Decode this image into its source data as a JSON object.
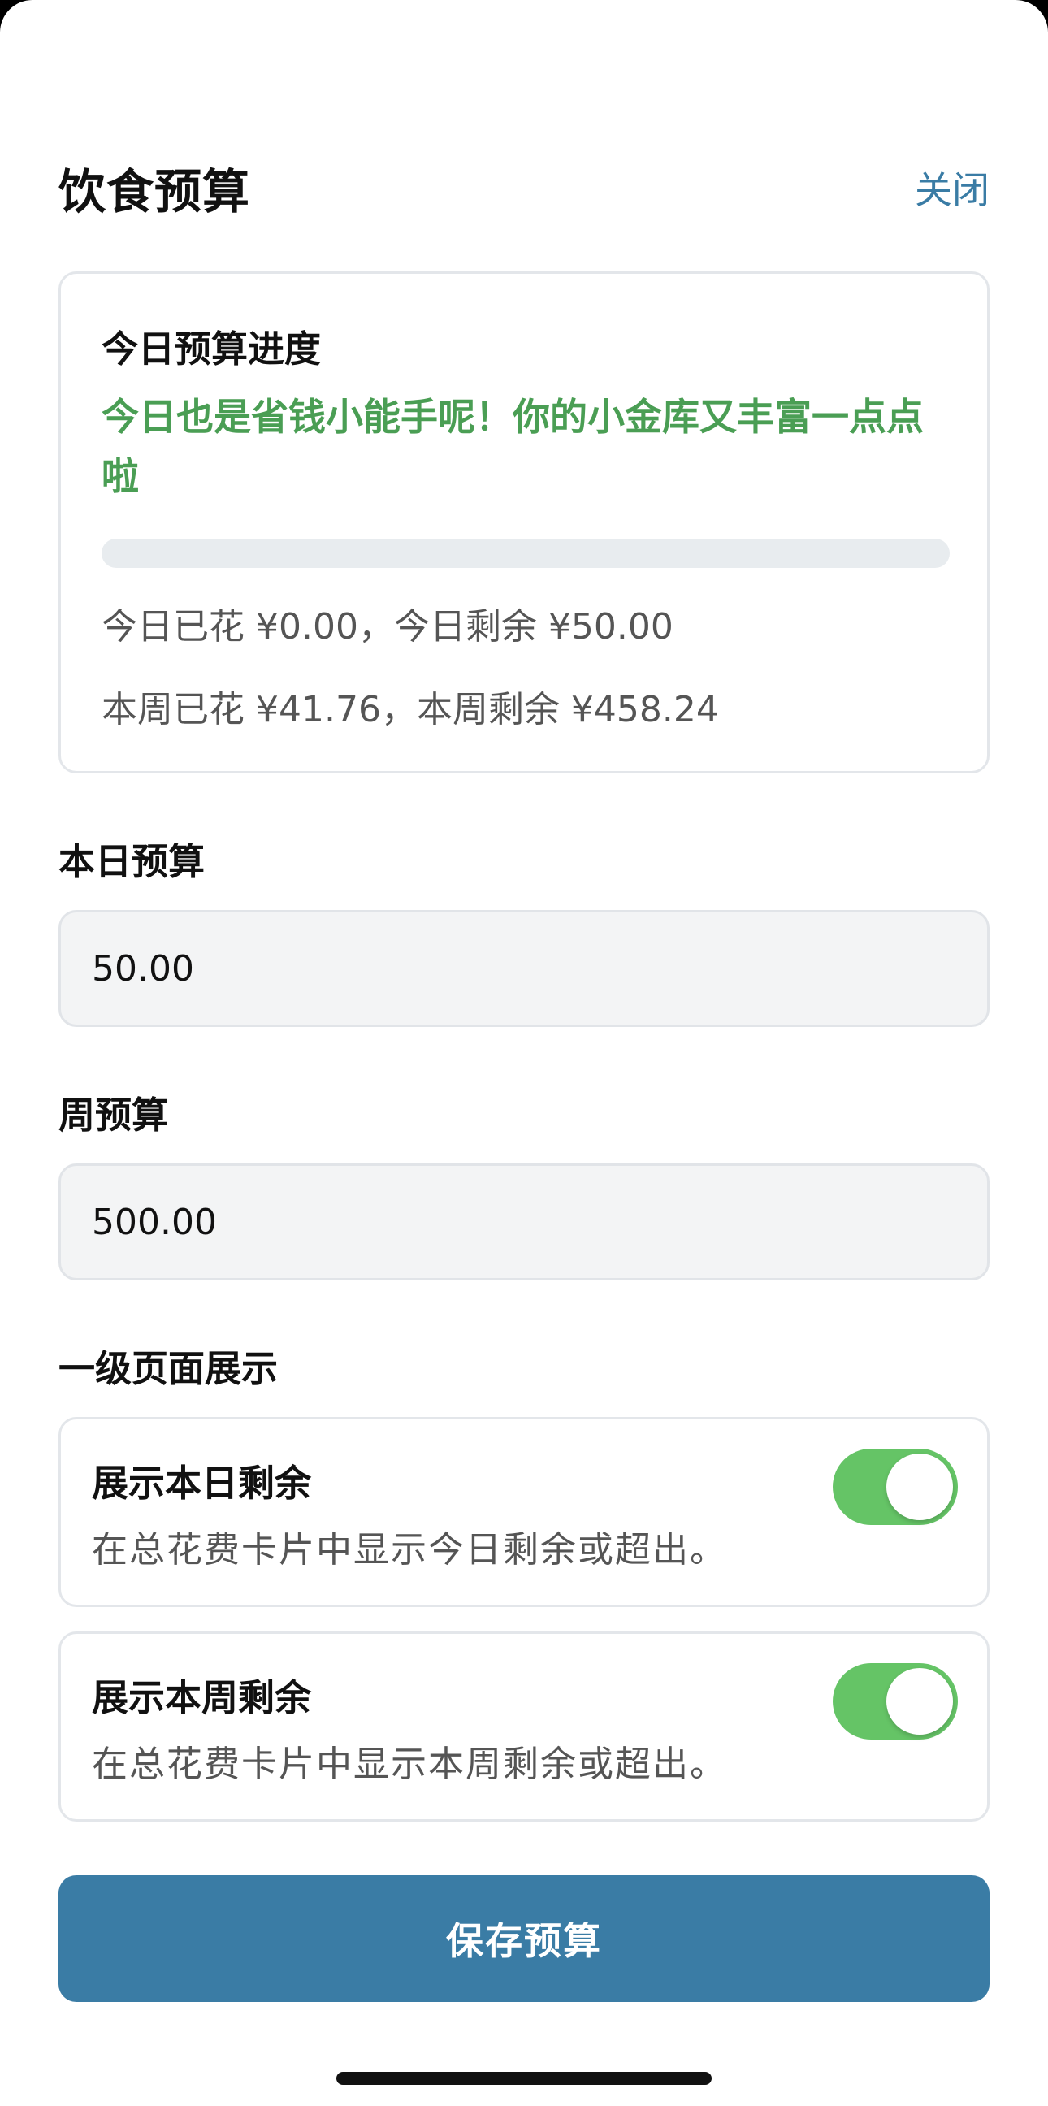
{
  "header": {
    "title": "饮食预算",
    "close_label": "关闭"
  },
  "progress": {
    "title": "今日预算进度",
    "message": "今日也是省钱小能手呢！你的小金库又丰富一点点啦",
    "today_spent_fraction": 0,
    "today_line": "今日已花 ¥0.00，今日剩余 ¥50.00",
    "week_line": "本周已花 ¥41.76，本周剩余 ¥458.24"
  },
  "daily_budget": {
    "label": "本日预算",
    "value": "50.00"
  },
  "weekly_budget": {
    "label": "周预算",
    "value": "500.00"
  },
  "display_section": {
    "label": "一级页面展示",
    "toggles": [
      {
        "title": "展示本日剩余",
        "description": "在总花费卡片中显示今日剩余或超出。",
        "enabled": true
      },
      {
        "title": "展示本周剩余",
        "description": "在总花费卡片中显示本周剩余或超出。",
        "enabled": true
      }
    ]
  },
  "save_button_label": "保存预算",
  "colors": {
    "accent": "#3a7ca5",
    "success_text": "#4a9e54",
    "toggle_on": "#65c466",
    "progress_track": "#e8ecef"
  }
}
